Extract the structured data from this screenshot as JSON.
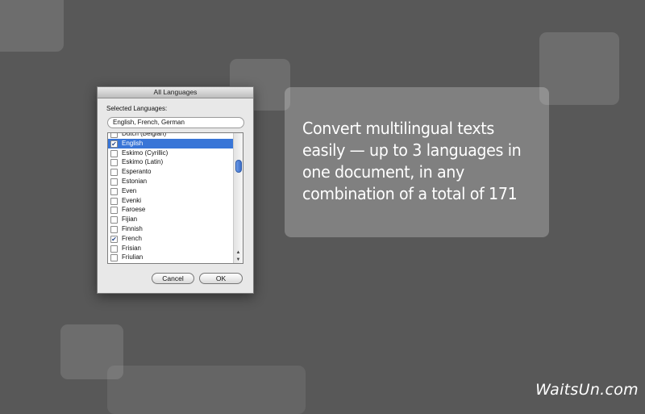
{
  "dialog": {
    "title": "All Languages",
    "selected_label": "Selected Languages:",
    "selected_value": "English, French, German",
    "languages": [
      {
        "label": "Dutch (Belgian)",
        "checked": false,
        "selected": false
      },
      {
        "label": "English",
        "checked": true,
        "selected": true
      },
      {
        "label": "Eskimo (Cyrillic)",
        "checked": false,
        "selected": false
      },
      {
        "label": "Eskimo (Latin)",
        "checked": false,
        "selected": false
      },
      {
        "label": "Esperanto",
        "checked": false,
        "selected": false
      },
      {
        "label": "Estonian",
        "checked": false,
        "selected": false
      },
      {
        "label": "Even",
        "checked": false,
        "selected": false
      },
      {
        "label": "Evenki",
        "checked": false,
        "selected": false
      },
      {
        "label": "Faroese",
        "checked": false,
        "selected": false
      },
      {
        "label": "Fijian",
        "checked": false,
        "selected": false
      },
      {
        "label": "Finnish",
        "checked": false,
        "selected": false
      },
      {
        "label": "French",
        "checked": true,
        "selected": false
      },
      {
        "label": "Frisian",
        "checked": false,
        "selected": false
      },
      {
        "label": "Friulian",
        "checked": false,
        "selected": false
      }
    ],
    "cancel_label": "Cancel",
    "ok_label": "OK"
  },
  "promo": {
    "text": "Convert multilingual texts easily — up to 3 languages in one document, in any combination of a total of 171"
  },
  "watermark": "WaitsUn.com",
  "colors": {
    "background": "#585858",
    "selection": "#3875d7"
  }
}
